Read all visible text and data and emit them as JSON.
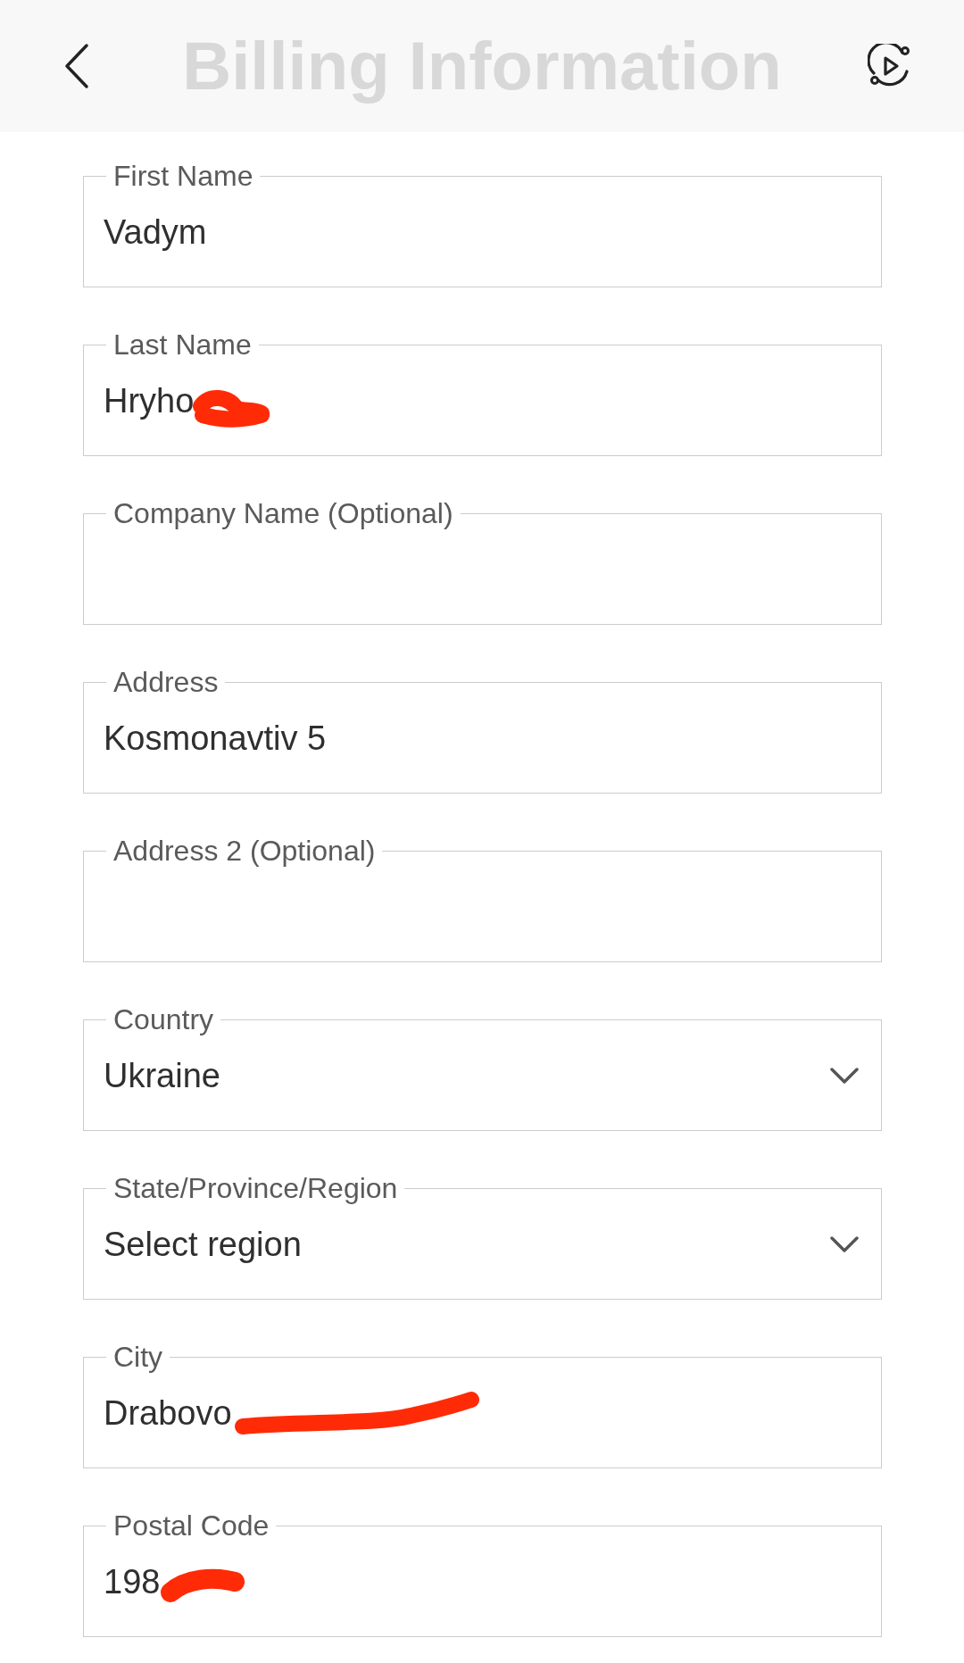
{
  "header": {
    "title": "Billing Information"
  },
  "fields": [
    {
      "kind": "text",
      "label": "First Name",
      "value": "Vadym",
      "redacted": false
    },
    {
      "kind": "text",
      "label": "Last Name",
      "value": "Hryho",
      "redacted": true
    },
    {
      "kind": "text",
      "label": "Company Name (Optional)",
      "redacted": false
    },
    {
      "kind": "text",
      "label": "Address",
      "value": "Kosmonavtiv 5",
      "redacted": false
    },
    {
      "kind": "text",
      "label": "Address 2 (Optional)",
      "redacted": false
    },
    {
      "kind": "select",
      "label": "Country",
      "value": "Ukraine",
      "redacted": false
    },
    {
      "kind": "select",
      "label": "State/Province/Region",
      "value": "Select region",
      "redacted": false
    },
    {
      "kind": "text",
      "label": "City",
      "value": "Drabovo",
      "redacted": true
    },
    {
      "kind": "text",
      "label": "Postal Code",
      "value": "198",
      "redacted": true
    }
  ]
}
